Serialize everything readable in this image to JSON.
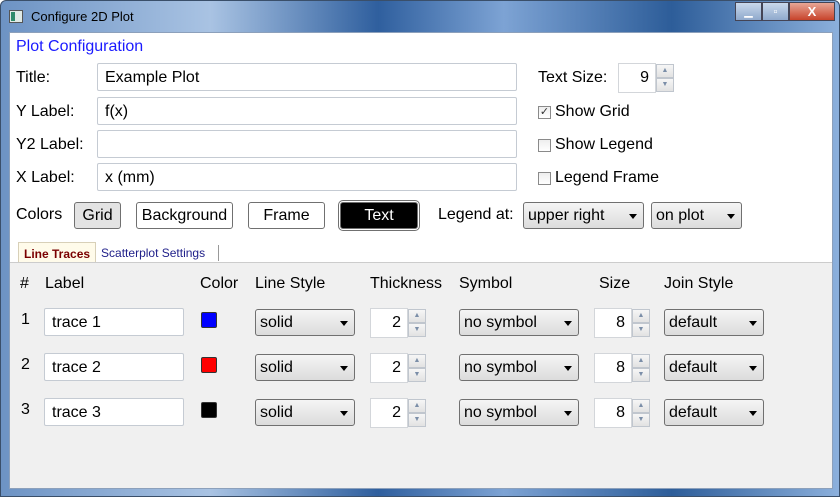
{
  "window": {
    "title": "Configure 2D Plot",
    "minimize": "▁",
    "maximize": "▫",
    "close": "X"
  },
  "header": "Plot Configuration",
  "fields": {
    "title": {
      "label": "Title:",
      "value": "Example Plot"
    },
    "ylabel": {
      "label": "Y Label:",
      "value": "f(x)"
    },
    "y2label": {
      "label": "Y2 Label:",
      "value": ""
    },
    "xlabel": {
      "label": "X Label:",
      "value": "x (mm)"
    }
  },
  "text_size": {
    "label": "Text Size:",
    "value": "9"
  },
  "checkboxes": {
    "show_grid": {
      "label": "Show Grid",
      "checked": true,
      "mark": "✓"
    },
    "show_legend": {
      "label": "Show Legend",
      "checked": false
    },
    "legend_frame": {
      "label": "Legend Frame",
      "checked": false
    }
  },
  "colors": {
    "label": "Colors",
    "grid": "Grid",
    "background": "Background",
    "frame": "Frame",
    "text": "Text"
  },
  "legend": {
    "label": "Legend at:",
    "position": "upper right",
    "placement": "on plot"
  },
  "tabs": [
    {
      "label": "Line Traces",
      "active": true
    },
    {
      "label": "Scatterplot Settings",
      "active": false
    }
  ],
  "table": {
    "headers": {
      "num": "#",
      "label": "Label",
      "color": "Color",
      "style": "Line Style",
      "thickness": "Thickness",
      "symbol": "Symbol",
      "size": "Size",
      "join": "Join Style"
    },
    "rows": [
      {
        "num": "1",
        "label": "trace 1",
        "color": "#0000ff",
        "style": "solid",
        "thickness": "2",
        "symbol": "no symbol",
        "size": "8",
        "join": "default"
      },
      {
        "num": "2",
        "label": "trace 2",
        "color": "#ff0000",
        "style": "solid",
        "thickness": "2",
        "symbol": "no symbol",
        "size": "8",
        "join": "default"
      },
      {
        "num": "3",
        "label": "trace 3",
        "color": "#000000",
        "style": "solid",
        "thickness": "2",
        "symbol": "no symbol",
        "size": "8",
        "join": "default"
      }
    ]
  }
}
